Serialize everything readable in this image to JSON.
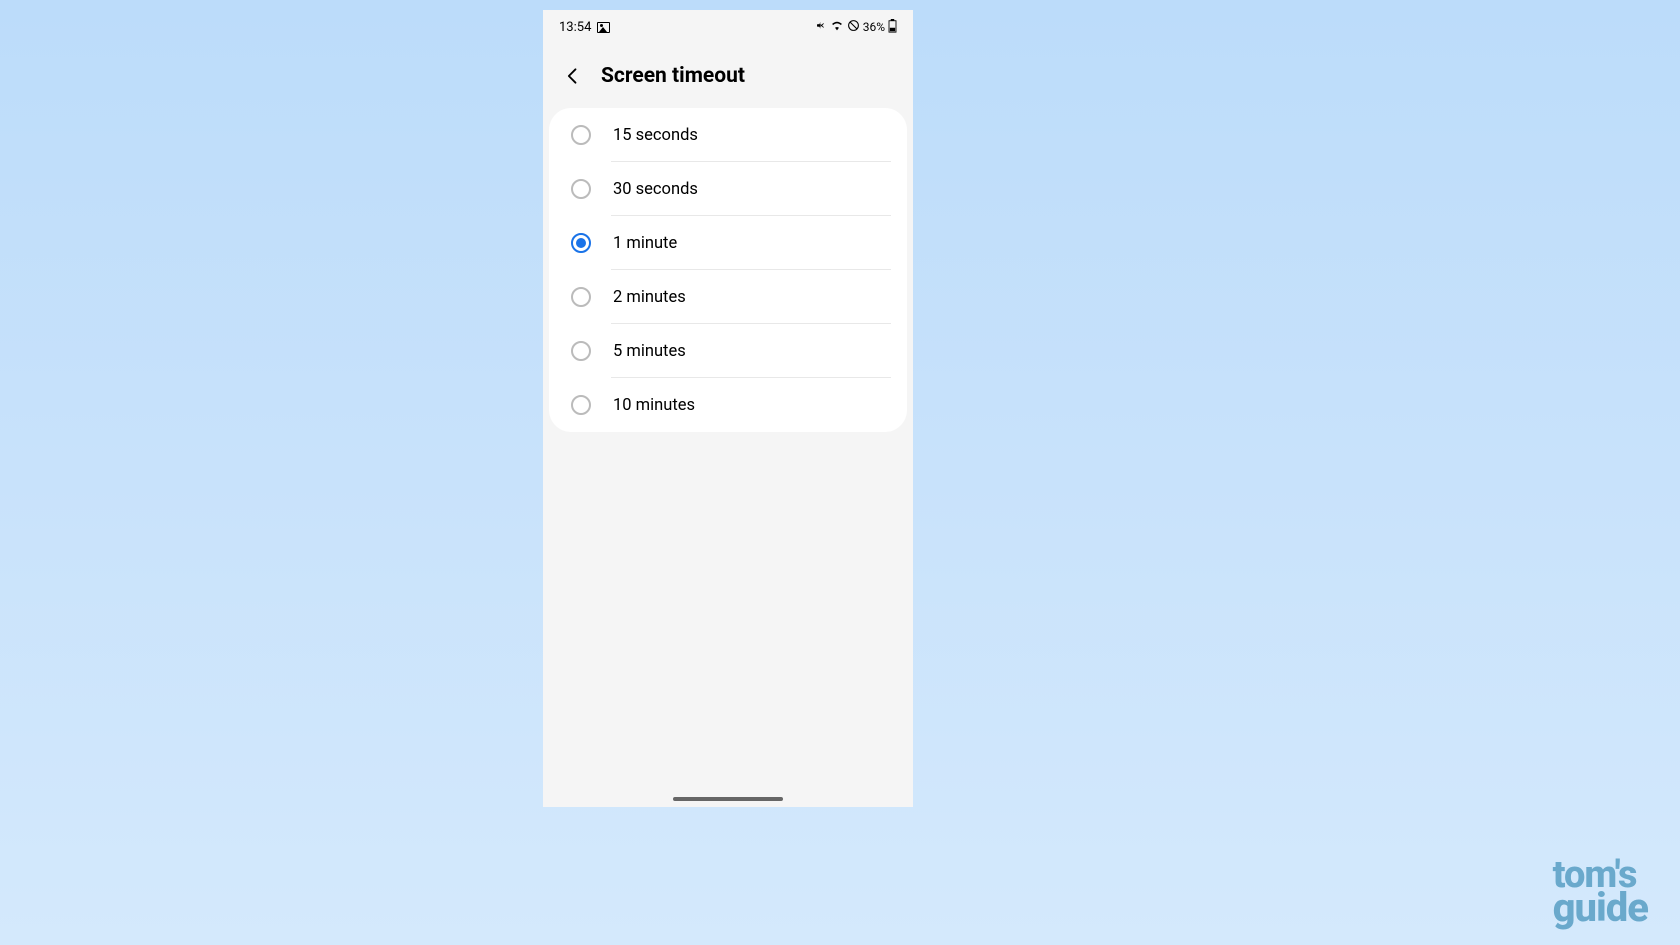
{
  "status_bar": {
    "time": "13:54",
    "battery_text": "36%"
  },
  "header": {
    "title": "Screen timeout"
  },
  "options": [
    {
      "label": "15 seconds",
      "selected": false
    },
    {
      "label": "30 seconds",
      "selected": false
    },
    {
      "label": "1 minute",
      "selected": true
    },
    {
      "label": "2 minutes",
      "selected": false
    },
    {
      "label": "5 minutes",
      "selected": false
    },
    {
      "label": "10 minutes",
      "selected": false
    }
  ],
  "watermark": {
    "line1": "tom's",
    "line2": "guide"
  }
}
